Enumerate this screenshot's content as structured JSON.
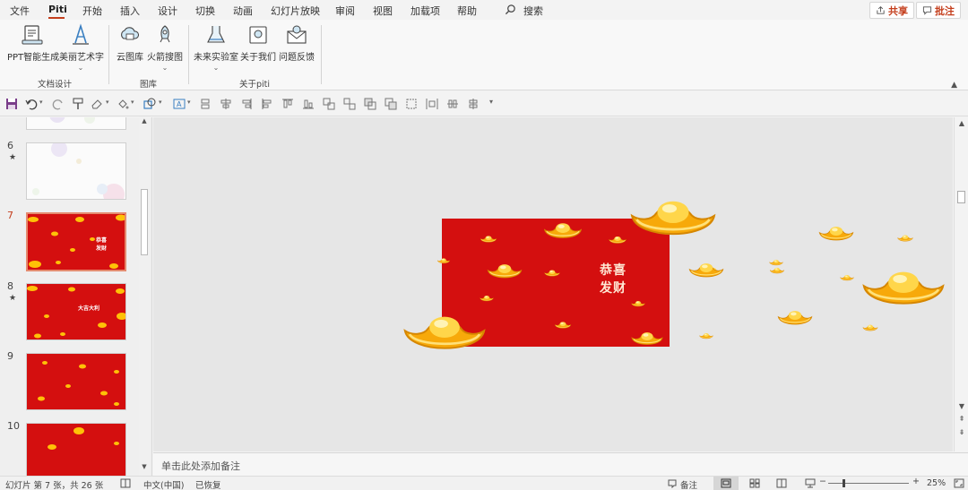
{
  "menu": {
    "tabs": [
      "文件",
      "Piti",
      "开始",
      "插入",
      "设计",
      "切换",
      "动画",
      "幻灯片放映",
      "审阅",
      "视图",
      "加载项",
      "帮助"
    ],
    "search_label": "搜索",
    "share_label": "共享",
    "comment_label": "批注"
  },
  "ribbon": {
    "buttons": [
      {
        "label": "PPT智能生成",
        "icon": "ppt-generate-icon"
      },
      {
        "label": "美丽艺术字",
        "icon": "art-text-icon"
      },
      {
        "label": "云图库",
        "icon": "cloud-library-icon"
      },
      {
        "label": "火箭搜图",
        "icon": "rocket-search-icon"
      },
      {
        "label": "未来实验室",
        "icon": "lab-flask-icon"
      },
      {
        "label": "关于我们",
        "icon": "about-us-icon"
      },
      {
        "label": "问题反馈",
        "icon": "feedback-mail-icon"
      }
    ],
    "groups": [
      "文档设计",
      "图库",
      "关于piti"
    ]
  },
  "thumbnails": {
    "slides": [
      {
        "number": "6",
        "starred": true
      },
      {
        "number": "7",
        "starred": false,
        "title": "恭喜\n发财"
      },
      {
        "number": "8",
        "starred": true,
        "title": "大吉大利"
      },
      {
        "number": "9",
        "starred": false
      },
      {
        "number": "10",
        "starred": false
      }
    ],
    "active_slide": "7"
  },
  "slide": {
    "title_line1": "恭喜",
    "title_line2": "发财",
    "background": "#d40f0f"
  },
  "notes": {
    "placeholder": "单击此处添加备注"
  },
  "status": {
    "slide_info": "幻灯片 第 7 张，共 26 张",
    "language": "中文(中国)",
    "recovered": "已恢复",
    "notes_label": "备注",
    "zoom": "25%"
  },
  "colors": {
    "accent": "#c43e1c",
    "slide_red": "#d40f0f",
    "gold": "#ffc107"
  }
}
